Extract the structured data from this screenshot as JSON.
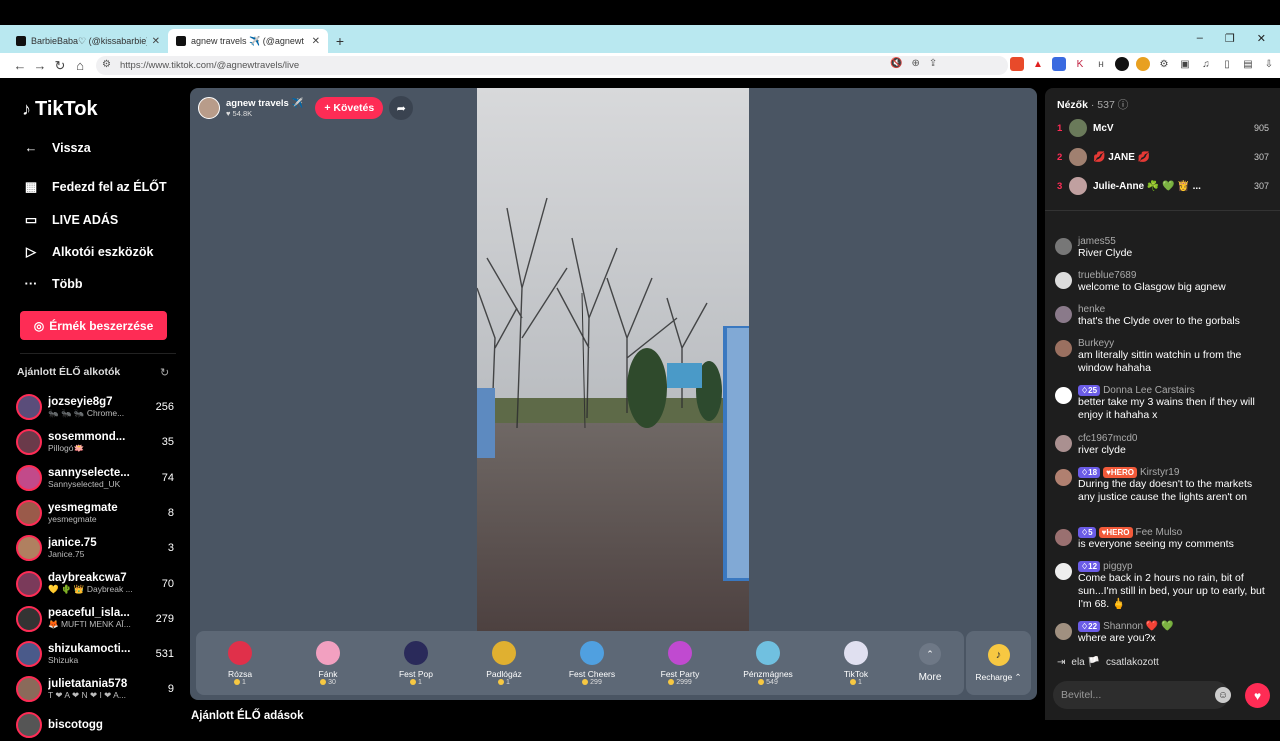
{
  "browser": {
    "tabs": [
      {
        "title": "BarbieBaba♡ (@kissabarbie) ÉLŐ a"
      },
      {
        "title": "agnew travels ✈️ (@agnewt"
      }
    ],
    "url": "https://www.tiktok.com/@agnewtravels/live"
  },
  "sidebar": {
    "logo": "TikTok",
    "back": "Vissza",
    "nav": [
      "Fedezd fel az ÉLŐT",
      "LIVE ADÁS",
      "Alkotói eszközök",
      "Több"
    ],
    "coins_button": "Érmék beszerzése",
    "recommended_title": "Ajánlott ÉLŐ alkotók",
    "creators": [
      {
        "name": "jozseyie8g7",
        "sub": "🐜 🐜 🐜 Chrome...",
        "count": "256",
        "color": "#5a4d7a"
      },
      {
        "name": "sosemmond...",
        "sub": "Pillogó🪷",
        "count": "35",
        "color": "#6a3a4a"
      },
      {
        "name": "sannyselecte...",
        "sub": "Sannyselected_UK",
        "count": "74",
        "color": "#c24a8a"
      },
      {
        "name": "yesmegmate",
        "sub": "yesmegmate",
        "count": "8",
        "color": "#9a5a4a"
      },
      {
        "name": "janice.75",
        "sub": "Janice.75",
        "count": "3",
        "color": "#b08060"
      },
      {
        "name": "daybreakcwa7",
        "sub": "💛 🌵 👑 Daybreak ...",
        "count": "70",
        "color": "#7a3a5a"
      },
      {
        "name": "peaceful_isla...",
        "sub": "🦊 MUFTI MENK AĪ...",
        "count": "279",
        "color": "#333333"
      },
      {
        "name": "shizukamocti...",
        "sub": "Shizuka",
        "count": "531",
        "color": "#4a5a8a"
      },
      {
        "name": "julietatania578",
        "sub": "T ❤ A ❤ N ❤ I ❤ A...",
        "count": "9",
        "color": "#8a6a5a"
      },
      {
        "name": "biscotogg",
        "sub": "",
        "count": "",
        "color": "#555555"
      }
    ]
  },
  "stream": {
    "host_name": "agnew travels ✈️",
    "host_likes": "54.8K",
    "follow_label": "+ Követés",
    "gifts": [
      {
        "name": "Rózsa",
        "price": "1",
        "color": "#e0304a"
      },
      {
        "name": "Fánk",
        "price": "30",
        "color": "#f2a0c0"
      },
      {
        "name": "Fest Pop",
        "price": "1",
        "color": "#2a2a5a"
      },
      {
        "name": "Padlógáz",
        "price": "1",
        "color": "#e0b030"
      },
      {
        "name": "Fest Cheers",
        "price": "299",
        "color": "#50a0e0"
      },
      {
        "name": "Fest Party",
        "price": "2999",
        "color": "#c04ad0"
      },
      {
        "name": "Pénzmágnes",
        "price": "549",
        "color": "#70c0e0"
      },
      {
        "name": "TikTok",
        "price": "1",
        "color": "#e0e0f0"
      }
    ],
    "more_label": "More",
    "recharge_label": "Recharge ⌃",
    "below_title": "Ajánlott ÉLŐ adások"
  },
  "panel": {
    "viewers_title": "Nézők",
    "viewers_count": "· 537",
    "top_viewers": [
      {
        "rank": "1",
        "name": "McV",
        "score": "905",
        "color": "#6a7a5a"
      },
      {
        "rank": "2",
        "name": "💋 JANE 💋",
        "score": "307",
        "color": "#a08070"
      },
      {
        "rank": "3",
        "name": "Julie-Anne ☘️ 💚 👸 ...",
        "score": "307",
        "color": "#c0a0a0"
      }
    ],
    "comments": [
      {
        "user": "james55",
        "text": "River Clyde",
        "level": "",
        "hero": false,
        "color": "#777777"
      },
      {
        "user": "trueblue7689",
        "text": "welcome to Glasgow big agnew",
        "level": "",
        "hero": false,
        "color": "#dddddd"
      },
      {
        "user": "henke",
        "text": "that's the Clyde over to the gorbals",
        "level": "",
        "hero": false,
        "color": "#8a7a8a"
      },
      {
        "user": "Burkeyy",
        "text": "am literally sittin watchin u from the window hahaha",
        "level": "",
        "hero": false,
        "color": "#9a7060"
      },
      {
        "user": "Donna Lee Carstairs",
        "text": "better take my 3 wains then if they will enjoy it hahaha x",
        "level": "25",
        "hero": false,
        "color": "#ffffff"
      },
      {
        "user": "cfc1967mcd0",
        "text": "river clyde",
        "level": "",
        "hero": false,
        "color": "#aa9090"
      },
      {
        "user": "Kirstyr19",
        "text": "During the day doesn't to the markets any justice cause the lights aren't on",
        "level": "18",
        "hero": true,
        "color": "#b08070"
      },
      {
        "user": "Fee Mulso",
        "text": "is everyone seeing my comments",
        "level": "5",
        "hero": true,
        "color": "#9a7070"
      },
      {
        "user": "piggyp",
        "text": "Come back in 2 hours no rain, bit of sun...I'm still in bed, your up to early, but I'm 68. 🖕",
        "level": "12",
        "hero": false,
        "color": "#eeeeee"
      },
      {
        "user": "Shannon ❤️ 💚",
        "text": "where are you?x",
        "level": "22",
        "hero": false,
        "color": "#a09080"
      }
    ],
    "hero_label": "HERO",
    "joined_user": "ela 🏳️",
    "joined_text": "csatlakozott",
    "input_placeholder": "Bevitel..."
  }
}
